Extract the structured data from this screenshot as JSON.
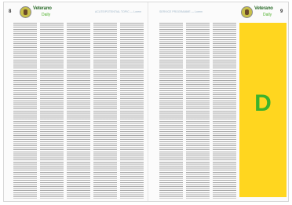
{
  "left_page": {
    "page_number": "8",
    "logo": {
      "word": "Veterano",
      "sub": "Daily"
    },
    "running_head": "ACUTE/POTENTIAL TOPIC — Lorem"
  },
  "right_page": {
    "page_number": "9",
    "logo": {
      "word": "Veterano",
      "sub": "Daily"
    },
    "running_head": "SERVICE PROGRAMME — Lorem",
    "panel": {
      "letter": "D",
      "background": "#ffd61f",
      "letter_color": "#3cb32c"
    }
  },
  "colors": {
    "text_lines": "#9a9a9a",
    "logo_green": "#2e6f2e",
    "panel_yellow": "#ffd61f"
  }
}
